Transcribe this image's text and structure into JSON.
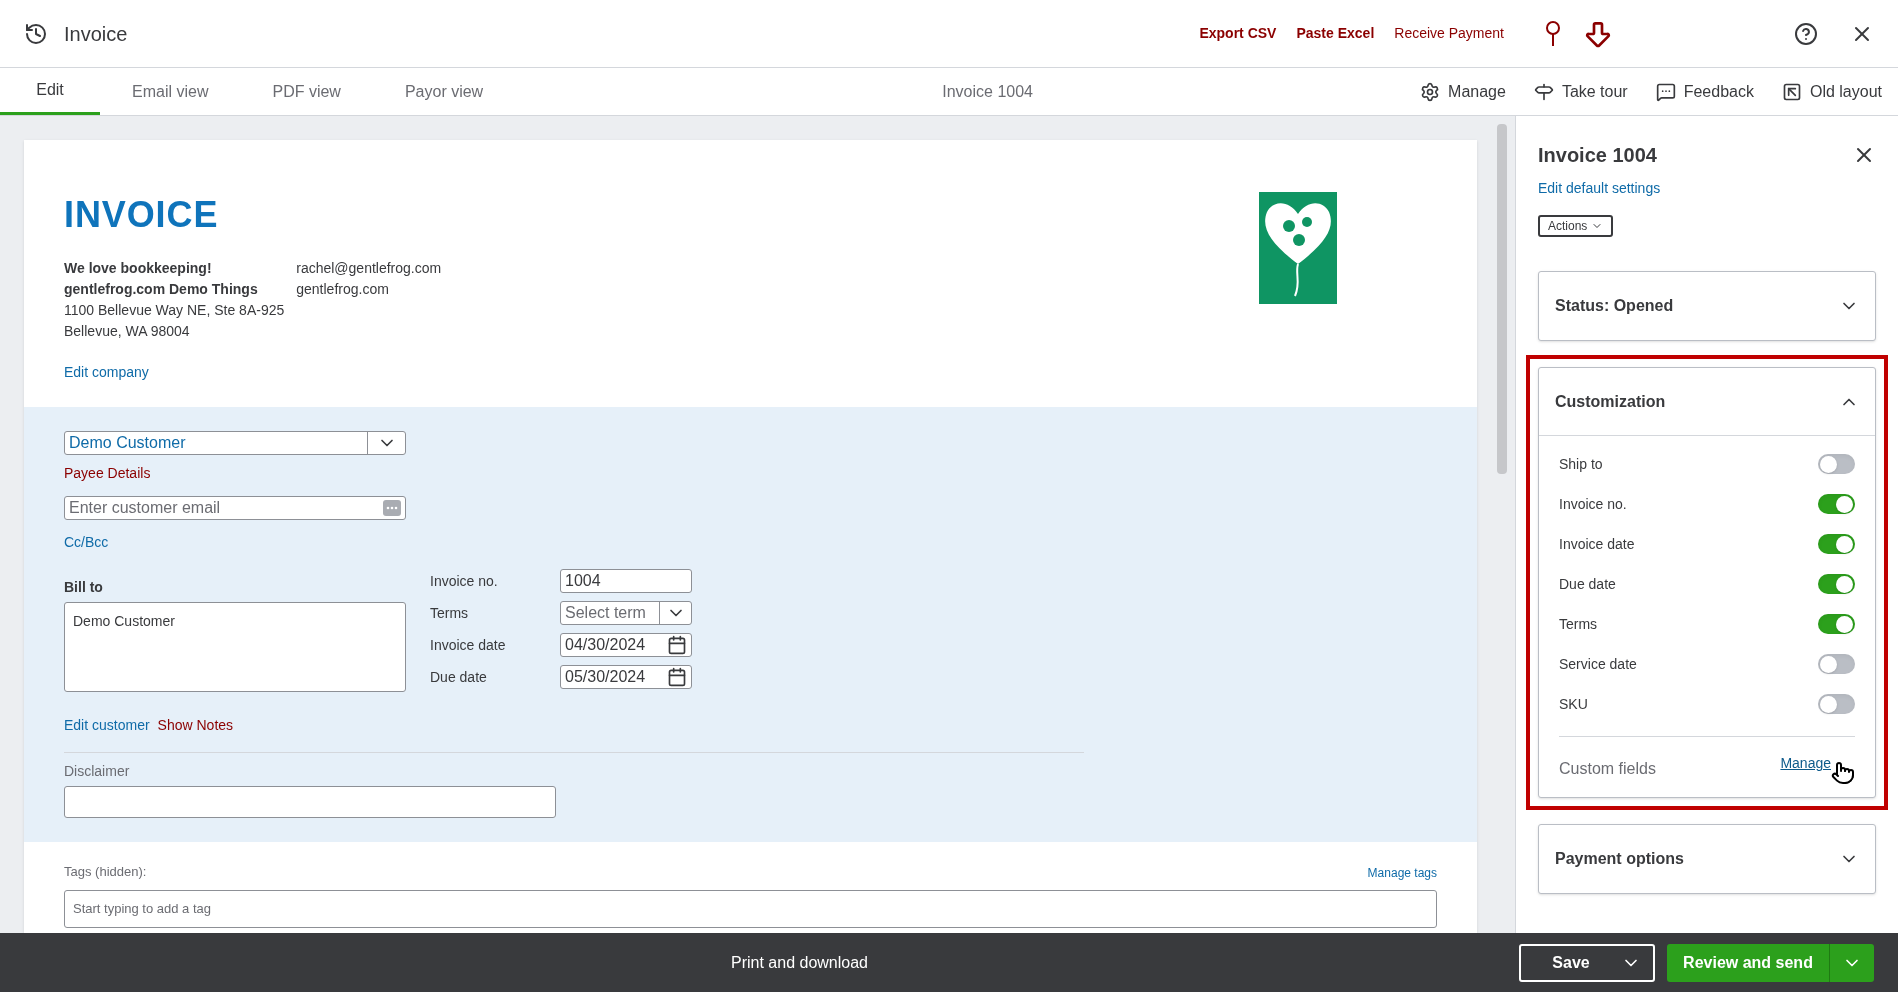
{
  "header": {
    "title": "Invoice",
    "actions": [
      "Export CSV",
      "Paste Excel",
      "Receive Payment"
    ]
  },
  "tabs": [
    {
      "label": "Edit",
      "selected": true
    },
    {
      "label": "Email view",
      "selected": false
    },
    {
      "label": "PDF view",
      "selected": false
    },
    {
      "label": "Payor view",
      "selected": false
    }
  ],
  "document_title": "Invoice 1004",
  "toolbar": [
    {
      "kind": "settings",
      "label": "Manage"
    },
    {
      "kind": "tour",
      "label": "Take tour"
    },
    {
      "kind": "feedback",
      "label": "Feedback"
    },
    {
      "kind": "layout",
      "label": "Old layout"
    }
  ],
  "invoice": {
    "heading": "INVOICE",
    "company_lines": [
      {
        "text": "We love bookkeeping!",
        "bold": true
      },
      {
        "text": "gentlefrog.com Demo Things",
        "bold": true
      },
      {
        "text": "1100 Bellevue Way NE, Ste 8A-925",
        "bold": false
      },
      {
        "text": "Bellevue, WA 98004",
        "bold": false
      }
    ],
    "contact_lines": [
      "rachel@gentlefrog.com",
      "gentlefrog.com"
    ],
    "edit_company": "Edit company",
    "customer": "Demo Customer",
    "payee_details": "Payee Details",
    "email_placeholder": "Enter customer email",
    "cc_bcc": "Cc/Bcc",
    "bill_to_label": "Bill to",
    "bill_to_value": "Demo Customer",
    "fields": [
      {
        "kind": "text",
        "label": "Invoice no.",
        "value": "1004"
      },
      {
        "kind": "select",
        "label": "Terms",
        "placeholder": "Select term"
      },
      {
        "kind": "date",
        "label": "Invoice date",
        "value": "04/30/2024"
      },
      {
        "kind": "date",
        "label": "Due date",
        "value": "05/30/2024"
      }
    ],
    "edit_customer": "Edit customer",
    "show_notes": "Show Notes",
    "disclaimer_label": "Disclaimer",
    "tags_label": "Tags (hidden):",
    "manage_tags": "Manage tags",
    "tags_placeholder": "Start typing to add a tag"
  },
  "panel": {
    "title": "Invoice 1004",
    "edit_default": "Edit default settings",
    "actions": "Actions",
    "sections": [
      {
        "title": "Status: Opened",
        "expanded": false,
        "highlighted": false
      },
      {
        "title": "Customization",
        "expanded": true,
        "highlighted": true,
        "toggles": [
          {
            "label": "Ship to",
            "on": false
          },
          {
            "label": "Invoice no.",
            "on": true
          },
          {
            "label": "Invoice date",
            "on": true
          },
          {
            "label": "Due date",
            "on": true
          },
          {
            "label": "Terms",
            "on": true
          },
          {
            "label": "Service date",
            "on": false
          },
          {
            "label": "SKU",
            "on": false
          }
        ],
        "custom_fields": "Custom fields",
        "custom_fields_link": "Manage"
      },
      {
        "title": "Payment options",
        "expanded": false,
        "highlighted": false
      }
    ]
  },
  "footer": {
    "print": "Print and download",
    "save": "Save",
    "send": "Review and send"
  }
}
